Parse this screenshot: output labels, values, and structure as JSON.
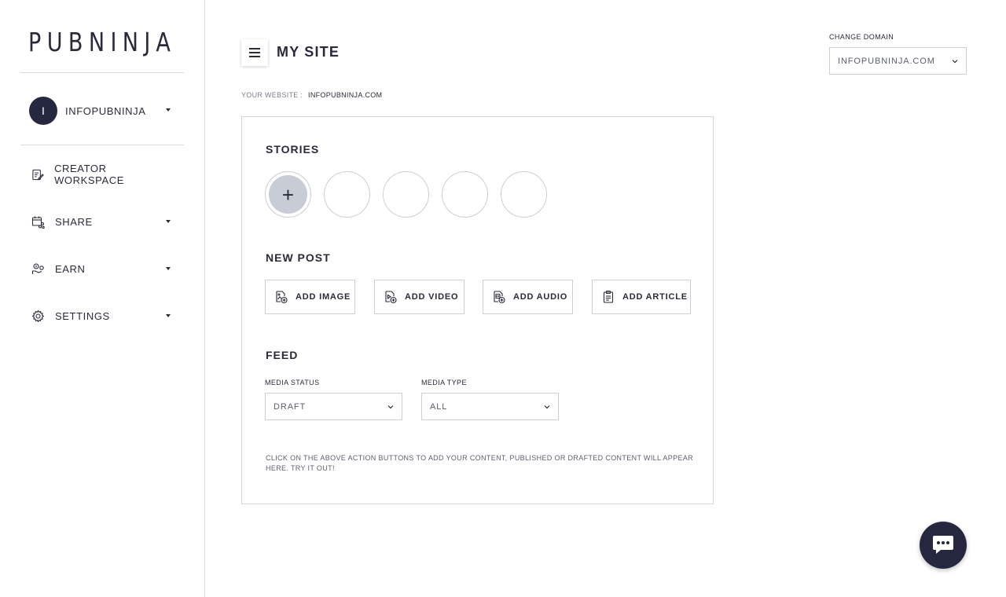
{
  "sidebar": {
    "logo": "PUBNINJA",
    "account": {
      "initial": "I",
      "name": "INFOPUBNINJA"
    },
    "items": [
      {
        "label": "CREATOR WORKSPACE",
        "icon": "edit-document-icon",
        "has_dropdown": false
      },
      {
        "label": "SHARE",
        "icon": "share-calendar-icon",
        "has_dropdown": true
      },
      {
        "label": "EARN",
        "icon": "earn-money-icon",
        "has_dropdown": true
      },
      {
        "label": "SETTINGS",
        "icon": "gear-icon",
        "has_dropdown": true
      }
    ]
  },
  "header": {
    "title": "MY SITE",
    "website_label": "YOUR WEBSITE :",
    "website_value": "INFOPUBNINJA.COM",
    "change_domain_label": "CHANGE DOMAIN",
    "domain_selected": "INFOPUBNINJA.COM"
  },
  "stories": {
    "title": "STORIES",
    "add_symbol": "+"
  },
  "new_post": {
    "title": "NEW POST",
    "buttons": [
      {
        "label": "ADD IMAGE",
        "icon": "add-image-icon"
      },
      {
        "label": "ADD VIDEO",
        "icon": "add-video-icon"
      },
      {
        "label": "ADD AUDIO",
        "icon": "add-audio-icon"
      },
      {
        "label": "ADD ARTICLE",
        "icon": "add-article-icon"
      }
    ]
  },
  "feed": {
    "title": "FEED",
    "media_status_label": "MEDIA STATUS",
    "media_status_value": "DRAFT",
    "media_type_label": "MEDIA TYPE",
    "media_type_value": "ALL",
    "hint": "CLICK ON THE ABOVE ACTION BUTTONS TO ADD YOUR CONTENT, PUBLISHED OR DRAFTED CONTENT WILL APPEAR HERE. TRY IT OUT!"
  },
  "chat": {
    "icon": "chat-bubble-icon"
  },
  "colors": {
    "primary_dark": "#262840",
    "border": "#d6d6d6",
    "story_add_bg": "#c8ccd6"
  }
}
